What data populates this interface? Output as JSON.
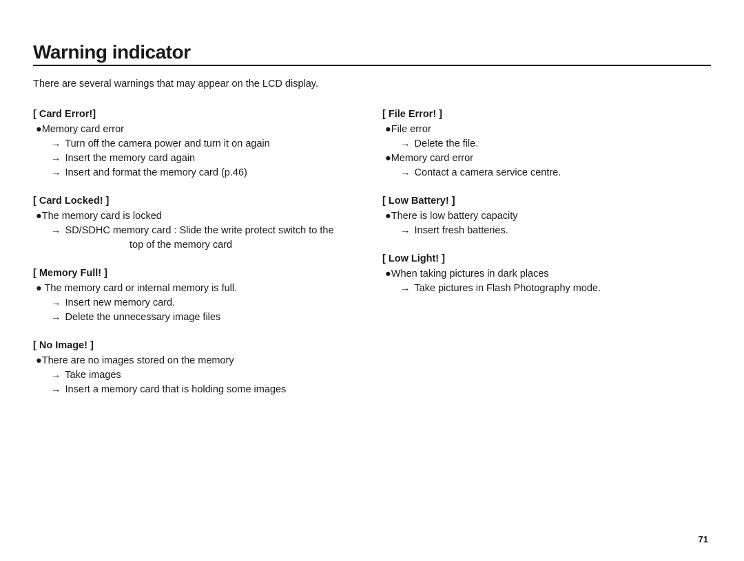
{
  "title": "Warning indicator",
  "intro": "There are several warnings that may appear on the LCD display.",
  "page_number": "71",
  "bullet_glyph": "●",
  "arrow_glyph": "→",
  "left": [
    {
      "heading": "[ Card Error!]",
      "items": [
        {
          "cause": "Memory card error",
          "actions": [
            "Turn off the camera power and turn it on again",
            "Insert the memory card again",
            "Insert and format the memory card (p.46)"
          ]
        }
      ]
    },
    {
      "heading": "[ Card Locked! ]",
      "items": [
        {
          "cause": "The memory card is locked",
          "actions": [
            "SD/SDHC memory card : Slide the write protect switch to the"
          ],
          "cont": "top of the memory card"
        }
      ]
    },
    {
      "heading": "[ Memory Full! ]",
      "items": [
        {
          "cause": " The memory card or internal memory is full.",
          "actions": [
            "Insert new memory card.",
            "Delete the unnecessary image files"
          ]
        }
      ]
    },
    {
      "heading": "[ No Image! ]",
      "items": [
        {
          "cause": "There are no images stored on the memory",
          "actions": [
            "Take images",
            "Insert a memory card that is holding some images"
          ]
        }
      ]
    }
  ],
  "right": [
    {
      "heading": "[ File Error! ]",
      "items": [
        {
          "cause": "File error",
          "actions": [
            "Delete the file."
          ]
        },
        {
          "cause": "Memory card error",
          "actions": [
            "Contact a camera service centre."
          ]
        }
      ]
    },
    {
      "heading": "[ Low Battery! ]",
      "items": [
        {
          "cause": "There is low battery capacity",
          "actions": [
            "Insert fresh batteries."
          ]
        }
      ]
    },
    {
      "heading": "[ Low Light! ]",
      "items": [
        {
          "cause": "When taking pictures in dark places",
          "actions": [
            "Take pictures in Flash Photography mode."
          ]
        }
      ]
    }
  ]
}
